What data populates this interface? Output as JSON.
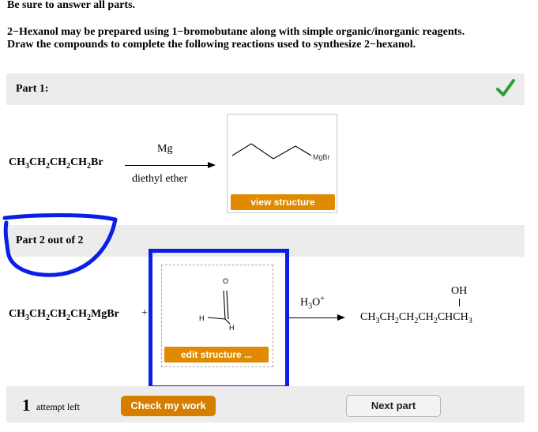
{
  "instructions": {
    "heading": "Be sure to answer all parts.",
    "line1": "2−Hexanol may be prepared using 1−bromobutane along with simple organic/inorganic reagents.",
    "line2": "Draw the compounds to complete the following reactions used to synthesize 2−hexanol."
  },
  "part1": {
    "label": "Part 1:",
    "status_icon": "checkmark-icon",
    "status_color": "#2a9d3a",
    "reactant": [
      "CH",
      "3",
      "CH",
      "2",
      "CH",
      "2",
      "CH",
      "2",
      "Br"
    ],
    "reagent_above": "Mg",
    "reagent_below": "diethyl ether",
    "product_label": "MgBr",
    "view_button": "view structure"
  },
  "part2": {
    "label": "Part 2 out of 2",
    "reactant": [
      "CH",
      "3",
      "CH",
      "2",
      "CH",
      "2",
      "CH",
      "2",
      "MgBr"
    ],
    "plus": "+",
    "atom_o": "O",
    "atom_h_left": "H",
    "atom_h_right": "H",
    "edit_button": "edit structure ...",
    "reagent_above": [
      "H",
      "3",
      "O",
      "+"
    ],
    "product_oh": "OH",
    "product": [
      "CH",
      "3",
      "CH",
      "2",
      "CH",
      "2",
      "CH",
      "2",
      "CHCH",
      "3"
    ]
  },
  "footer": {
    "attempts_count": "1",
    "attempts_text": "attempt left",
    "check_button": "Check my work",
    "next_button": "Next part"
  },
  "annotation_color": "#0a1ee6",
  "accent_color": "#e08a00"
}
